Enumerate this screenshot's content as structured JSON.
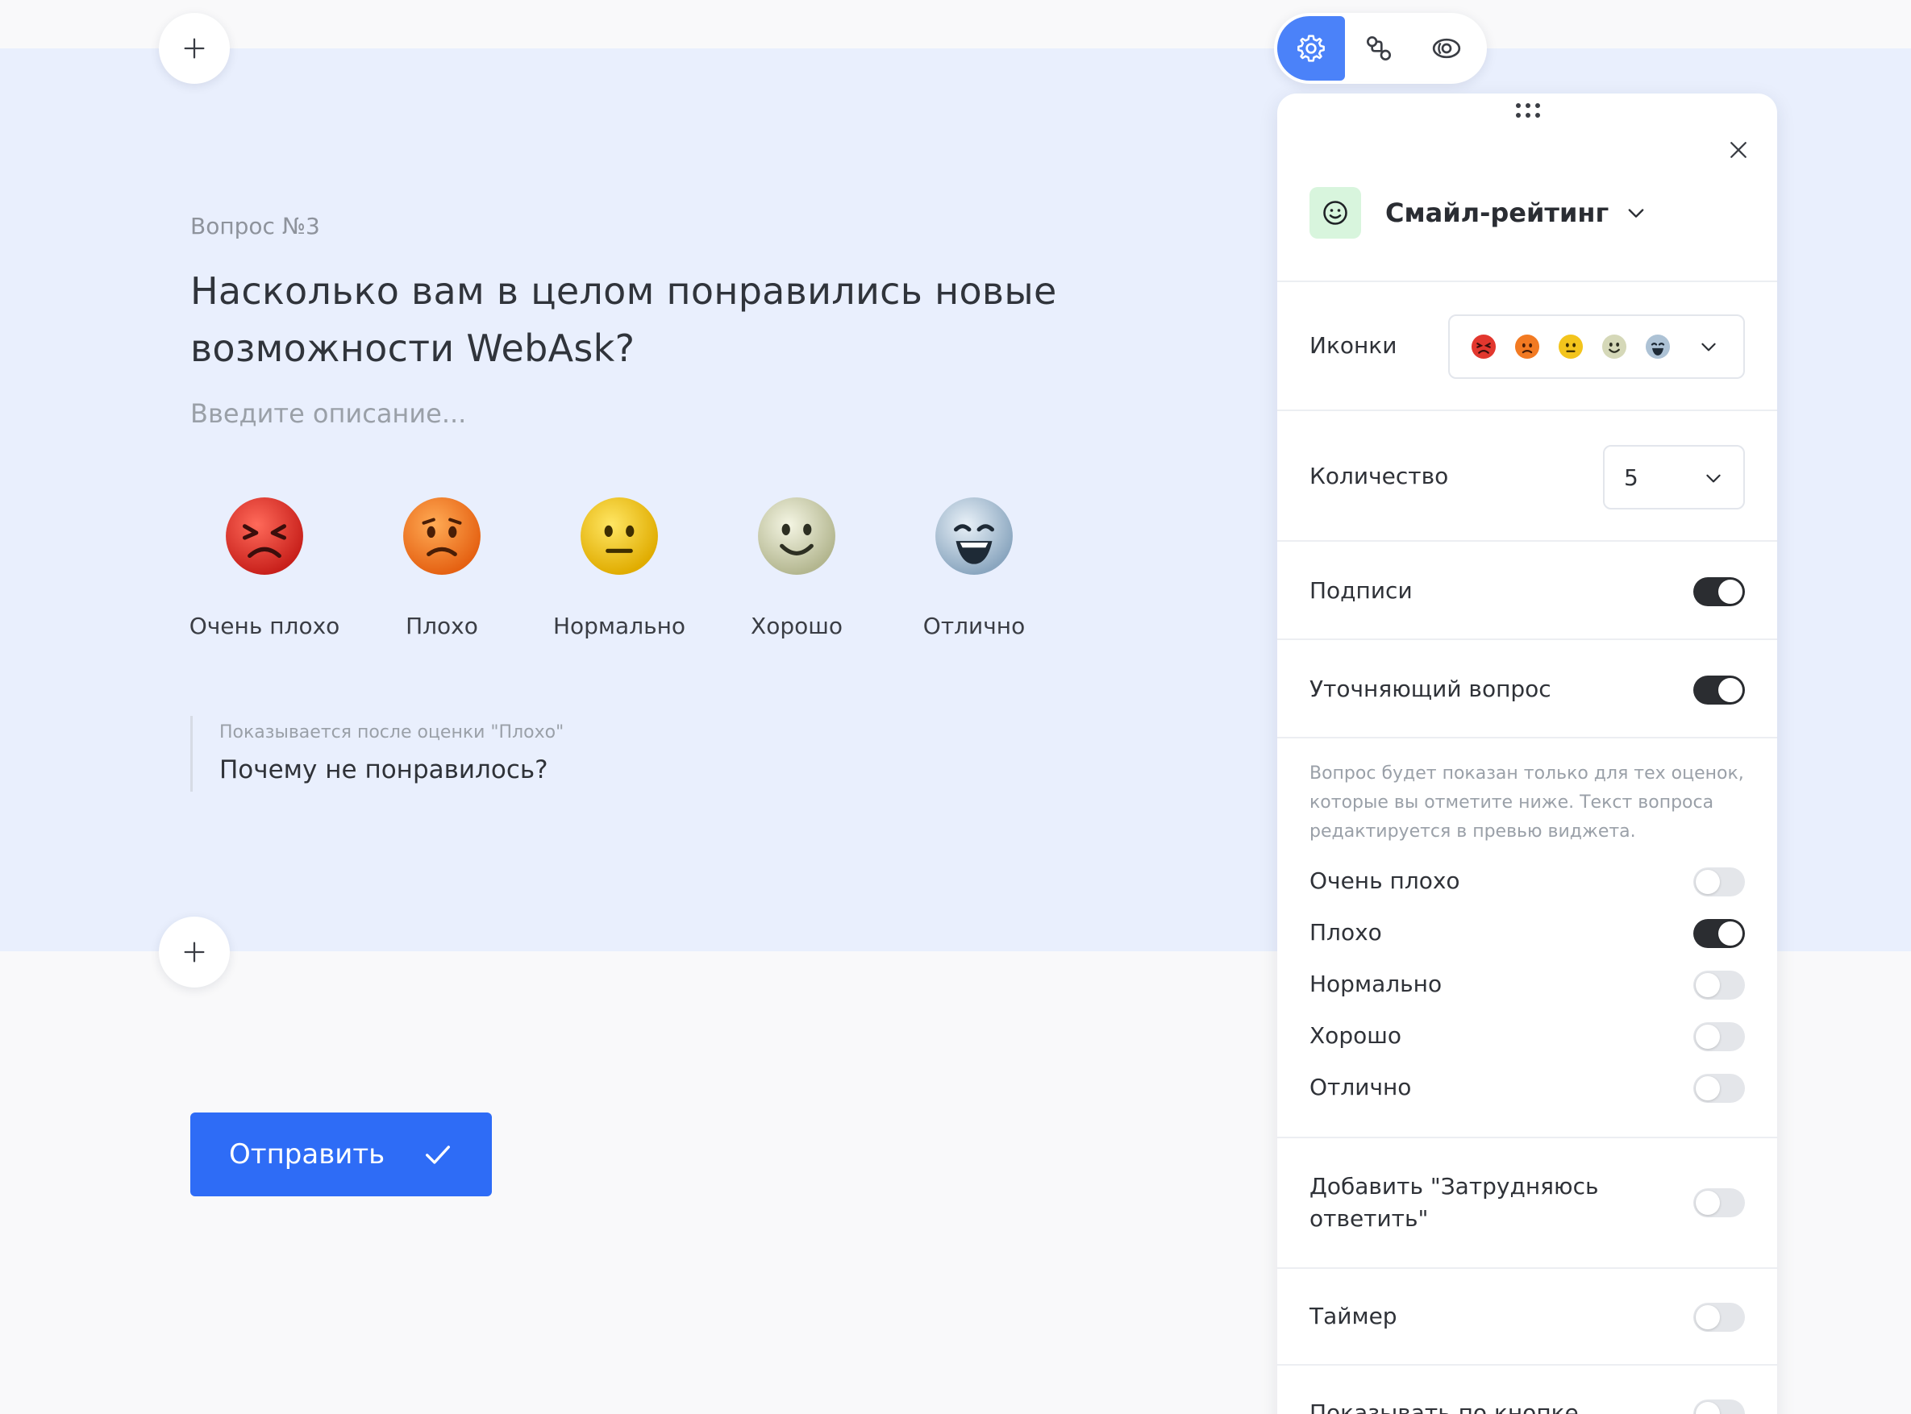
{
  "question": {
    "number": "Вопрос №3",
    "title": "Насколько вам в целом понравились новые возможности WebAsk?",
    "description_placeholder": "Введите описание..."
  },
  "ratings": [
    {
      "label": "Очень плохо",
      "icon": "furious-face-icon",
      "color": "#e8352f"
    },
    {
      "label": "Плохо",
      "icon": "sad-face-icon",
      "color": "#f47a1f"
    },
    {
      "label": "Нормально",
      "icon": "neutral-face-icon",
      "color": "#f2c51d"
    },
    {
      "label": "Хорошо",
      "icon": "smiling-face-icon",
      "color": "#cfd3b4"
    },
    {
      "label": "Отлично",
      "icon": "grinning-face-icon",
      "color": "#a8bfd3"
    }
  ],
  "followup": {
    "hint": "Показывается после оценки \"Плохо\"",
    "question": "Почему не понравилось?"
  },
  "submit": {
    "label": "Отправить"
  },
  "colors": {
    "accent": "#2e6cf6",
    "canvas": "#e9effd",
    "toggle_on": "#2b2d31"
  },
  "panel": {
    "type_label": "Смайл-рейтинг",
    "icons_label": "Иконки",
    "count_label": "Количество",
    "count_value": "5",
    "captions_label": "Подписи",
    "captions_on": true,
    "clarify_label": "Уточняющий вопрос",
    "clarify_on": true,
    "clarify_hint": "Вопрос будет показан только для тех оценок, которые вы отметите ниже. Текст вопроса редактируется в превью виджета.",
    "clarify_options": [
      {
        "label": "Очень плохо",
        "on": false
      },
      {
        "label": "Плохо",
        "on": true
      },
      {
        "label": "Нормально",
        "on": false
      },
      {
        "label": "Хорошо",
        "on": false
      },
      {
        "label": "Отлично",
        "on": false
      }
    ],
    "difficult_label": "Добавить \"Затрудняюсь ответить\"",
    "difficult_on": false,
    "timer_label": "Таймер",
    "timer_on": false,
    "button_label": "Показывать по кнопке",
    "button_on": false
  }
}
